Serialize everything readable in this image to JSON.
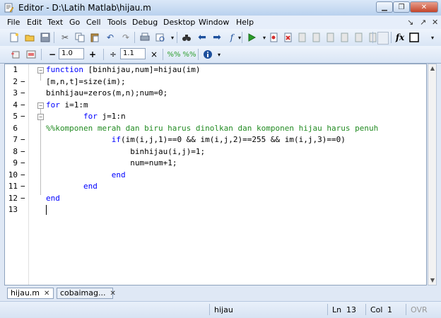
{
  "window": {
    "title": "Editor - D:\\Latih Matlab\\hijau.m"
  },
  "menu": [
    "File",
    "Edit",
    "Text",
    "Go",
    "Cell",
    "Tools",
    "Debug",
    "Desktop",
    "Window",
    "Help"
  ],
  "cell_toolbar": {
    "subtract_value": "1.0",
    "divide_value": "1.1"
  },
  "code": [
    {
      "n": "1",
      "dash": "",
      "fold": "−",
      "indent": "",
      "parts": [
        {
          "t": "function",
          "c": "kw"
        },
        {
          "t": " [binhijau,num]=hijau(im)",
          "c": ""
        }
      ]
    },
    {
      "n": "2",
      "dash": "−",
      "fold": "",
      "indent": "",
      "parts": [
        {
          "t": "[m,n,t]=size(im);",
          "c": ""
        }
      ]
    },
    {
      "n": "3",
      "dash": "−",
      "fold": "",
      "indent": "",
      "parts": [
        {
          "t": "binhijau=zeros(m,n);num=0;",
          "c": ""
        }
      ]
    },
    {
      "n": "4",
      "dash": "−",
      "fold": "−",
      "indent": "",
      "parts": [
        {
          "t": "for",
          "c": "kw"
        },
        {
          "t": " i=1:m",
          "c": ""
        }
      ]
    },
    {
      "n": "5",
      "dash": "−",
      "fold": "−",
      "indent": "        ",
      "parts": [
        {
          "t": "for",
          "c": "kw"
        },
        {
          "t": " j=1:n",
          "c": ""
        }
      ]
    },
    {
      "n": "6",
      "dash": "",
      "fold": "",
      "indent": "",
      "parts": [
        {
          "t": "%%komponen merah dan biru harus dinolkan dan komponen hijau harus penuh",
          "c": "cm"
        }
      ]
    },
    {
      "n": "7",
      "dash": "−",
      "fold": "",
      "indent": "              ",
      "parts": [
        {
          "t": "if",
          "c": "kw"
        },
        {
          "t": "(im(i,j,1)==0 && im(i,j,2)==255 && im(i,j,3)==0)",
          "c": ""
        }
      ]
    },
    {
      "n": "8",
      "dash": "−",
      "fold": "",
      "indent": "                  ",
      "parts": [
        {
          "t": "binhijau(i,j)=1;",
          "c": ""
        }
      ]
    },
    {
      "n": "9",
      "dash": "−",
      "fold": "",
      "indent": "                  ",
      "parts": [
        {
          "t": "num=num+1;",
          "c": ""
        }
      ]
    },
    {
      "n": "10",
      "dash": "−",
      "fold": "",
      "indent": "              ",
      "parts": [
        {
          "t": "end",
          "c": "kw"
        }
      ]
    },
    {
      "n": "11",
      "dash": "−",
      "fold": "",
      "indent": "        ",
      "parts": [
        {
          "t": "end",
          "c": "kw"
        }
      ]
    },
    {
      "n": "12",
      "dash": "−",
      "fold": "",
      "indent": "",
      "parts": [
        {
          "t": "end",
          "c": "kw"
        }
      ]
    },
    {
      "n": "13",
      "dash": "",
      "fold": "",
      "indent": "",
      "parts": []
    }
  ],
  "tabs": [
    {
      "label": "hijau.m",
      "active": true
    },
    {
      "label": "cobaimag...",
      "active": false
    }
  ],
  "status": {
    "file": "hijau",
    "ln_label": "Ln",
    "ln": "13",
    "col_label": "Col",
    "col": "1",
    "mode": "OVR"
  },
  "colors": {
    "keyword": "#0000ff",
    "comment": "#228b22"
  }
}
